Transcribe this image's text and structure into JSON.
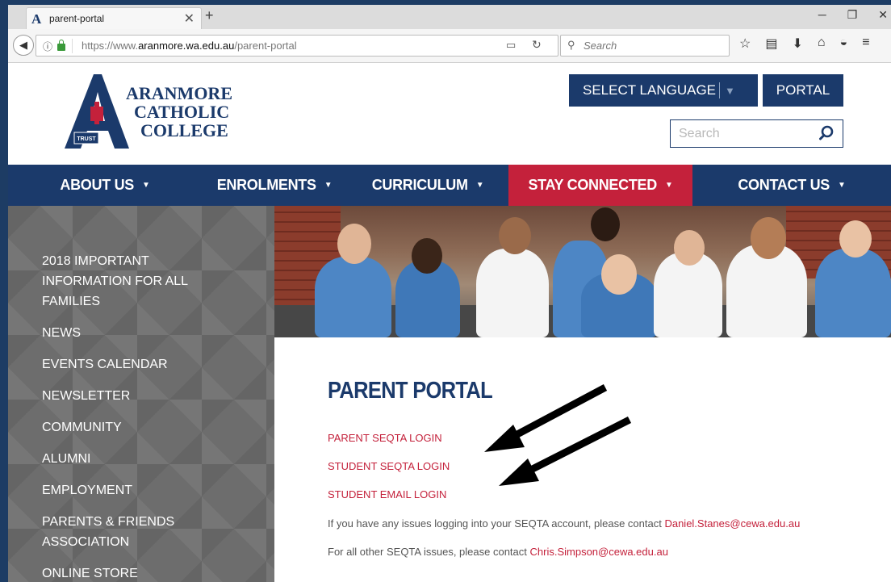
{
  "browser": {
    "tab_title": "parent-portal",
    "tab_favicon": "A",
    "new_tab": "+",
    "url_domain": "aranmore.wa.edu.au",
    "url_prefix": "https://www.",
    "url_path": "/parent-portal",
    "search_placeholder": "Search"
  },
  "site": {
    "logo_lines": [
      "ARANMORE",
      "CATHOLIC",
      "COLLEGE"
    ],
    "logo_badge": "TRUST",
    "select_language": "SELECT LANGUAGE",
    "portal": "PORTAL",
    "search_placeholder": "Search"
  },
  "mainnav": [
    {
      "label": "ABOUT US"
    },
    {
      "label": "ENROLMENTS"
    },
    {
      "label": "CURRICULUM"
    },
    {
      "label": "STAY CONNECTED"
    },
    {
      "label": "CONTACT US"
    }
  ],
  "sidebar": {
    "items": [
      "2018 IMPORTANT INFORMATION FOR ALL FAMILIES",
      "NEWS",
      "EVENTS CALENDAR",
      "NEWSLETTER",
      "COMMUNITY",
      "ALUMNI",
      "EMPLOYMENT",
      "PARENTS & FRIENDS ASSOCIATION",
      "ONLINE STORE"
    ]
  },
  "content": {
    "title": "PARENT PORTAL",
    "links": [
      "PARENT SEQTA LOGIN",
      "STUDENT SEQTA LOGIN",
      "STUDENT EMAIL LOGIN"
    ],
    "para1_text": "If you have any issues logging into your SEQTA account, please contact ",
    "para1_email": "Daniel.Stanes@cewa.edu.au",
    "para2_text": "For all other SEQTA issues, please contact ",
    "para2_email": "Chris.Simpson@cewa.edu.au"
  },
  "colors": {
    "navy": "#1b3a6b",
    "accent_red": "#c4213b",
    "sidebar_gray": "#6d6d6d"
  }
}
